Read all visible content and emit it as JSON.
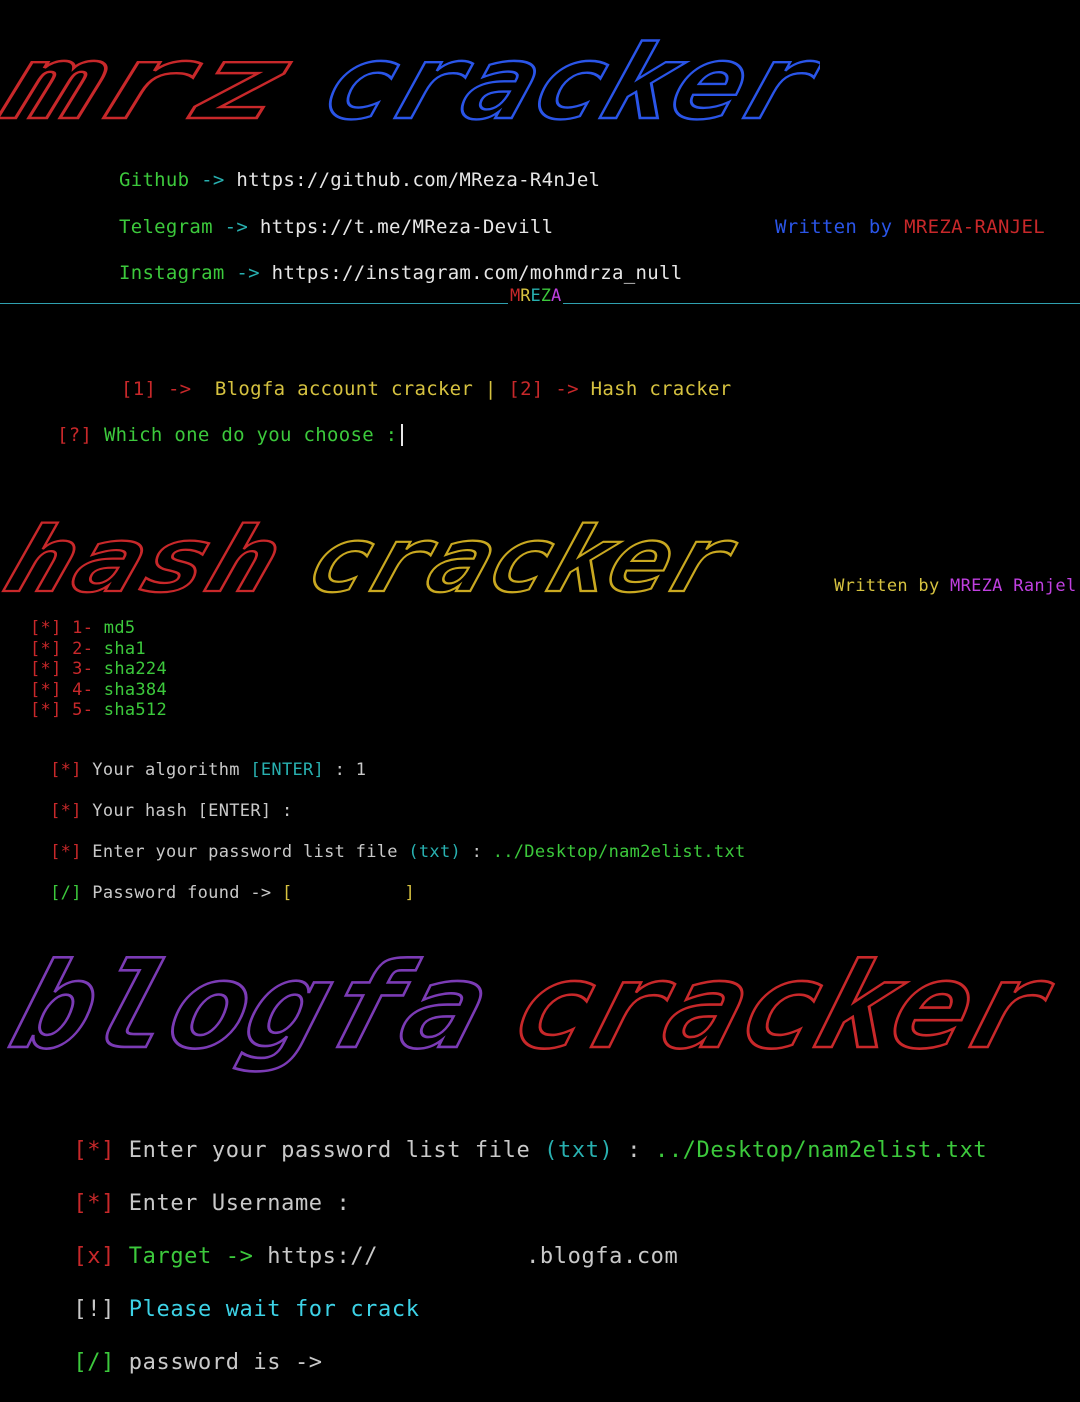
{
  "colors": {
    "background": "#000000",
    "red": "#c8282a",
    "green": "#3cc93c",
    "teal": "#28b0b0",
    "blue": "#2a55e8",
    "yellow": "#d6c240",
    "magenta": "#c040e0",
    "cyan": "#3dd2e6",
    "separator": "#2fa0b0"
  },
  "banner1": {
    "word1": "mrz",
    "word2": "cracker"
  },
  "links": {
    "github_label": "Github",
    "github_url": "https://github.com/MReza-R4nJel",
    "telegram_label": "Telegram",
    "telegram_url": "https://t.me/MReza-Devill",
    "instagram_label": "Instagram",
    "instagram_url": "https://instagram.com/mohmdrza_null",
    "arrow": "->"
  },
  "credit1": {
    "written_by": "Written by",
    "author": "MREZA-RANJEL"
  },
  "separator_label": {
    "m": "M",
    "r": "R",
    "e": "E",
    "z": "Z",
    "a": "A"
  },
  "main_menu": {
    "opt1_num": "[1]",
    "opt1_arrow": "->",
    "opt1_label": "Blogfa account cracker",
    "divider": "|",
    "opt2_num": "[2]",
    "opt2_arrow": "->",
    "opt2_label": "Hash cracker",
    "prompt_tag": "[?]",
    "prompt_text": "Which one do you choose :"
  },
  "banner2": {
    "word1": "hash",
    "word2": "cracker"
  },
  "credit2": {
    "written_by": "Written by",
    "author_first": "MREZA",
    "author_last": "Ranjel"
  },
  "hash_menu": {
    "items": [
      {
        "tag": "[*]",
        "num": "1-",
        "name": "md5"
      },
      {
        "tag": "[*]",
        "num": "2-",
        "name": "sha1"
      },
      {
        "tag": "[*]",
        "num": "3-",
        "name": "sha224"
      },
      {
        "tag": "[*]",
        "num": "4-",
        "name": "sha384"
      },
      {
        "tag": "[*]",
        "num": "5-",
        "name": "sha512"
      }
    ]
  },
  "hash_session": {
    "algo_tag": "[*]",
    "algo_text": "Your algorithm",
    "algo_hint": "[ENTER]",
    "algo_sep": ":",
    "algo_value": "1",
    "hash_tag": "[*]",
    "hash_text": "Your hash [ENTER]",
    "hash_sep": ":",
    "list_tag": "[*]",
    "list_text": "Enter your password list file",
    "list_hint": "(txt)",
    "list_sep": ":",
    "list_value": "../Desktop/nam2elist.txt",
    "found_tag": "[/]",
    "found_text": "Password found ->",
    "found_open": "[",
    "found_close": "]"
  },
  "banner3": {
    "word1": "blogfa",
    "word2": "cracker"
  },
  "blogfa_session": {
    "list_tag": "[*]",
    "list_text": "Enter your password list file",
    "list_hint": "(txt)",
    "list_sep": ":",
    "list_value": "../Desktop/nam2elist.txt",
    "user_tag": "[*]",
    "user_text": "Enter Username :",
    "target_tag": "[x]",
    "target_label": "Target",
    "target_arrow": "->",
    "target_prefix": "https://",
    "target_suffix": ".blogfa.com",
    "wait_tag": "[!]",
    "wait_text": "Please wait for crack",
    "result_tag": "[/]",
    "result_text": "password is ->"
  }
}
